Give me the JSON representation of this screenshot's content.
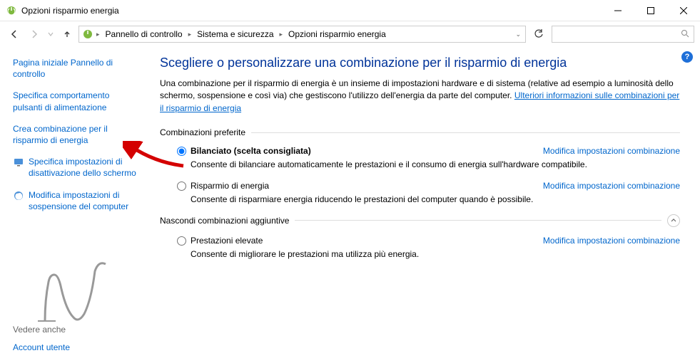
{
  "window": {
    "title": "Opzioni risparmio energia"
  },
  "breadcrumb": {
    "root": "Pannello di controllo",
    "mid": "Sistema e sicurezza",
    "leaf": "Opzioni risparmio energia"
  },
  "search": {
    "placeholder": ""
  },
  "sidebar": {
    "home": "Pagina iniziale Pannello di controllo",
    "link1": "Specifica comportamento pulsanti di alimentazione",
    "link2": "Crea combinazione per il risparmio di energia",
    "link3": "Specifica impostazioni di disattivazione dello schermo",
    "link4": "Modifica impostazioni di sospensione del computer",
    "see_also_label": "Vedere anche",
    "account": "Account utente"
  },
  "main": {
    "title": "Scegliere o personalizzare una combinazione per il risparmio di energia",
    "intro": "Una combinazione per il risparmio di energia è un insieme di impostazioni hardware e di sistema (relative ad esempio a luminosità dello schermo, sospensione e così via) che gestiscono l'utilizzo dell'energia da parte del computer. ",
    "intro_link": "Ulteriori informazioni sulle combinazioni per il risparmio di energia",
    "preferred_label": "Combinazioni preferite",
    "plan1": {
      "name": "Bilanciato (scelta consigliata)",
      "desc": "Consente di bilanciare automaticamente le prestazioni e il consumo di energia sull'hardware compatibile.",
      "modify": "Modifica impostazioni combinazione"
    },
    "plan2": {
      "name": "Risparmio di energia",
      "desc": "Consente di risparmiare energia riducendo le prestazioni del computer quando è possibile.",
      "modify": "Modifica impostazioni combinazione"
    },
    "additional_label": "Nascondi combinazioni aggiuntive",
    "plan3": {
      "name": "Prestazioni elevate",
      "desc": "Consente di migliorare le prestazioni ma utilizza più energia.",
      "modify": "Modifica impostazioni combinazione"
    }
  }
}
